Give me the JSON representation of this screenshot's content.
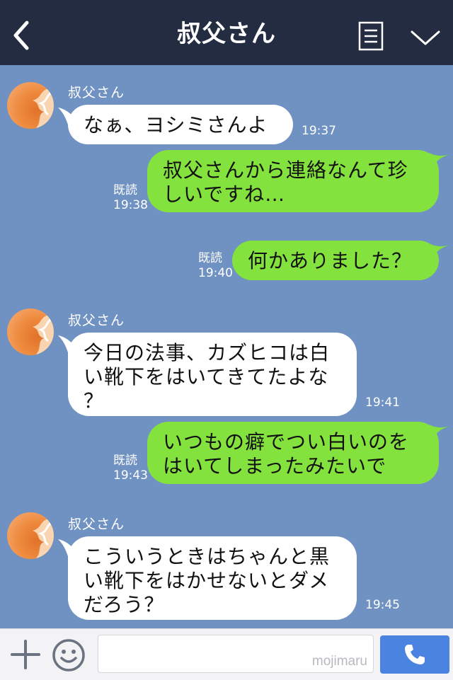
{
  "header": {
    "title": "叔父さん",
    "back_icon": "chevron-left-icon",
    "menu_icon": "list-icon",
    "expand_icon": "chevron-down-icon"
  },
  "messages": [
    {
      "from": "them",
      "sender": "叔父さん",
      "lines": [
        "なぁ、ヨシミさんよ"
      ],
      "time": "19:37"
    },
    {
      "from": "me",
      "read": "既読",
      "lines": [
        "叔父さんから連絡なんて珍",
        "しいですね…"
      ],
      "time": "19:38"
    },
    {
      "from": "me",
      "read": "既読",
      "lines": [
        "何かありました？"
      ],
      "time": "19:40"
    },
    {
      "from": "them",
      "sender": "叔父さん",
      "lines": [
        "今日の法事、カズヒコは白",
        "い靴下をはいてきてたよな",
        "？"
      ],
      "time": "19:41"
    },
    {
      "from": "me",
      "read": "既読",
      "lines": [
        "いつもの癖でつい白いのを",
        "はいてしまったみたいで"
      ],
      "time": "19:43"
    },
    {
      "from": "them",
      "sender": "叔父さん",
      "lines": [
        "こういうときはちゃんと黒",
        "い靴下をはかせないとダメ",
        "だろう？"
      ],
      "time": "19:45"
    }
  ],
  "footer": {
    "plus_icon": "plus-icon",
    "emoji_icon": "smiley-icon",
    "input_value": "",
    "watermark": "mojimaru",
    "send_icon": "phone-icon"
  },
  "colors": {
    "header_bg": "#232c40",
    "chat_bg": "#7092c2",
    "incoming_bubble": "#ffffff",
    "outgoing_bubble": "#84e23f",
    "send_button": "#4b83e0"
  }
}
